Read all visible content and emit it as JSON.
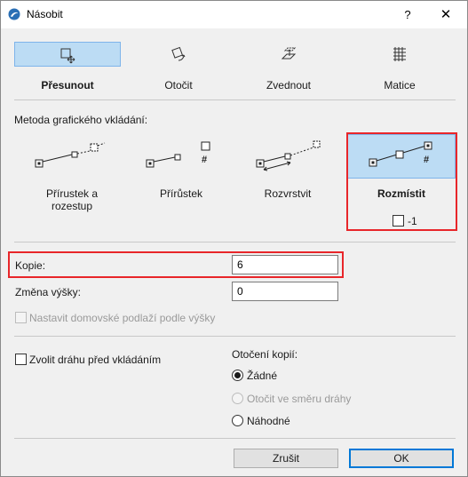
{
  "window": {
    "title": "Násobit",
    "help_label": "?",
    "close_label": "✕",
    "icon": "archicad-icon"
  },
  "operations": [
    {
      "label": "Přesunout",
      "icon": "move-icon",
      "selected": true
    },
    {
      "label": "Otočit",
      "icon": "rotate-icon",
      "selected": false
    },
    {
      "label": "Zvednout",
      "icon": "elevate-icon",
      "selected": false
    },
    {
      "label": "Matice",
      "icon": "matrix-icon",
      "selected": false
    }
  ],
  "method": {
    "section_label": "Metoda grafického vkládání:",
    "options": [
      {
        "label_line1": "Přírustek a",
        "label_line2": "rozestup",
        "icon": "increment-spacing-icon",
        "selected": false
      },
      {
        "label_line1": "Přírůstek",
        "label_line2": "",
        "icon": "increment-icon",
        "selected": false
      },
      {
        "label_line1": "Rozvrstvit",
        "label_line2": "",
        "icon": "spread-icon",
        "selected": false
      },
      {
        "label_line1": "Rozmístit",
        "label_line2": "",
        "icon": "distribute-icon",
        "selected": true
      }
    ],
    "minus_one_label": "-1",
    "minus_one_checked": false
  },
  "fields": {
    "copies_label": "Kopie:",
    "copies_value": "6",
    "height_label": "Změna výšky:",
    "height_value": "0",
    "home_story_label": "Nastavit domovské podlaží podle výšky"
  },
  "path": {
    "label": "Zvolit dráhu před vkládáním",
    "checked": false
  },
  "rotation": {
    "label": "Otočení kopií:",
    "options": [
      {
        "label": "Žádné",
        "checked": true,
        "disabled": false
      },
      {
        "label": "Otočit ve směru dráhy",
        "checked": false,
        "disabled": true
      },
      {
        "label": "Náhodné",
        "checked": false,
        "disabled": false
      }
    ]
  },
  "buttons": {
    "cancel": "Zrušit",
    "ok": "OK"
  },
  "colors": {
    "selection": "#bcdcf4",
    "highlight": "#e8262a",
    "primary_border": "#0078d7"
  }
}
